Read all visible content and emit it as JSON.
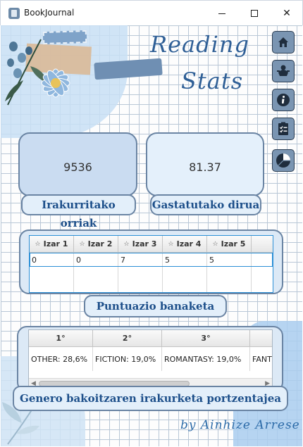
{
  "window": {
    "title": "BookJournal",
    "controls": {
      "minimize": "minimize",
      "maximize": "maximize",
      "close": "✕"
    }
  },
  "heading": {
    "line1": "Reading",
    "line2": "Stats"
  },
  "nav": {
    "items": [
      {
        "name": "home",
        "icon": "home-icon"
      },
      {
        "name": "character",
        "icon": "character-icon"
      },
      {
        "name": "info",
        "icon": "info-icon"
      },
      {
        "name": "list",
        "icon": "checklist-icon"
      },
      {
        "name": "stats",
        "icon": "pie-chart-icon"
      }
    ]
  },
  "stats": {
    "pages_value": "9536",
    "pages_label": "Irakurritako orriak",
    "money_value": "81.37",
    "money_label": "Gastatutako dirua"
  },
  "ratings": {
    "columns": [
      "Izar 1",
      "Izar 2",
      "Izar 3",
      "Izar 4",
      "Izar 5"
    ],
    "row": [
      "0",
      "0",
      "7",
      "5",
      "5"
    ],
    "label": "Puntuazio banaketa"
  },
  "genres": {
    "columns": [
      "1°",
      "2°",
      "3°",
      ""
    ],
    "row": [
      "OTHER: 28,6%",
      "FICTION: 19,0%",
      "ROMANTASY: 19,0%",
      "FANT"
    ],
    "label": "Genero bakoitzaren irakurketa portzentajea"
  },
  "signature": "by Ainhize Arrese",
  "colors": {
    "accent": "#1d4f8a",
    "card_border": "#6a84a3",
    "table_focus": "#2b8fd6",
    "nav_button": "#7a95b2"
  }
}
